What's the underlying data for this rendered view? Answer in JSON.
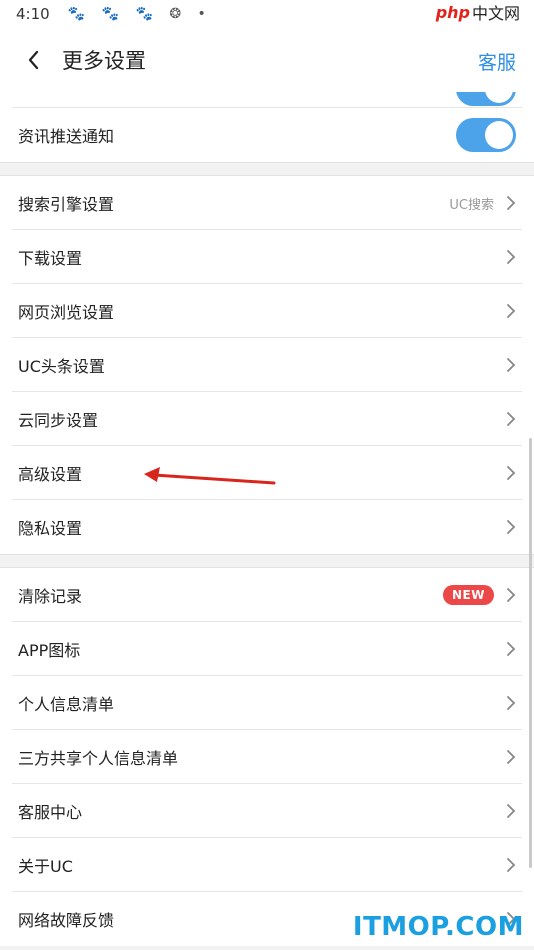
{
  "status_bar": {
    "time": "4:10",
    "icons": [
      "paw-icon",
      "paw-icon",
      "paw-icon",
      "aperture-icon",
      "dot-icon"
    ]
  },
  "watermark_top": {
    "php": "php",
    "cn": "中文网"
  },
  "header": {
    "title": "更多设置",
    "service": "客服",
    "accent_color": "#2e8fe6"
  },
  "groups": [
    {
      "items": [
        {
          "label": "资讯推送通知",
          "control": "toggle",
          "toggle_on": true
        }
      ]
    },
    {
      "items": [
        {
          "label": "搜索引擎设置",
          "value": "UC搜索"
        },
        {
          "label": "下载设置"
        },
        {
          "label": "网页浏览设置"
        },
        {
          "label": "UC头条设置"
        },
        {
          "label": "云同步设置"
        },
        {
          "label": "高级设置"
        },
        {
          "label": "隐私设置"
        }
      ]
    },
    {
      "items": [
        {
          "label": "清除记录",
          "badge": "NEW"
        },
        {
          "label": "APP图标"
        },
        {
          "label": "个人信息清单"
        },
        {
          "label": "三方共享个人信息清单"
        },
        {
          "label": "客服中心"
        },
        {
          "label": "关于UC"
        },
        {
          "label": "网络故障反馈"
        }
      ]
    }
  ],
  "colors": {
    "toggle_on": "#4da3ea",
    "badge": "#ec4848",
    "annotation_arrow": "#d9261c"
  },
  "watermark_bottom": "ITMOP.COM"
}
